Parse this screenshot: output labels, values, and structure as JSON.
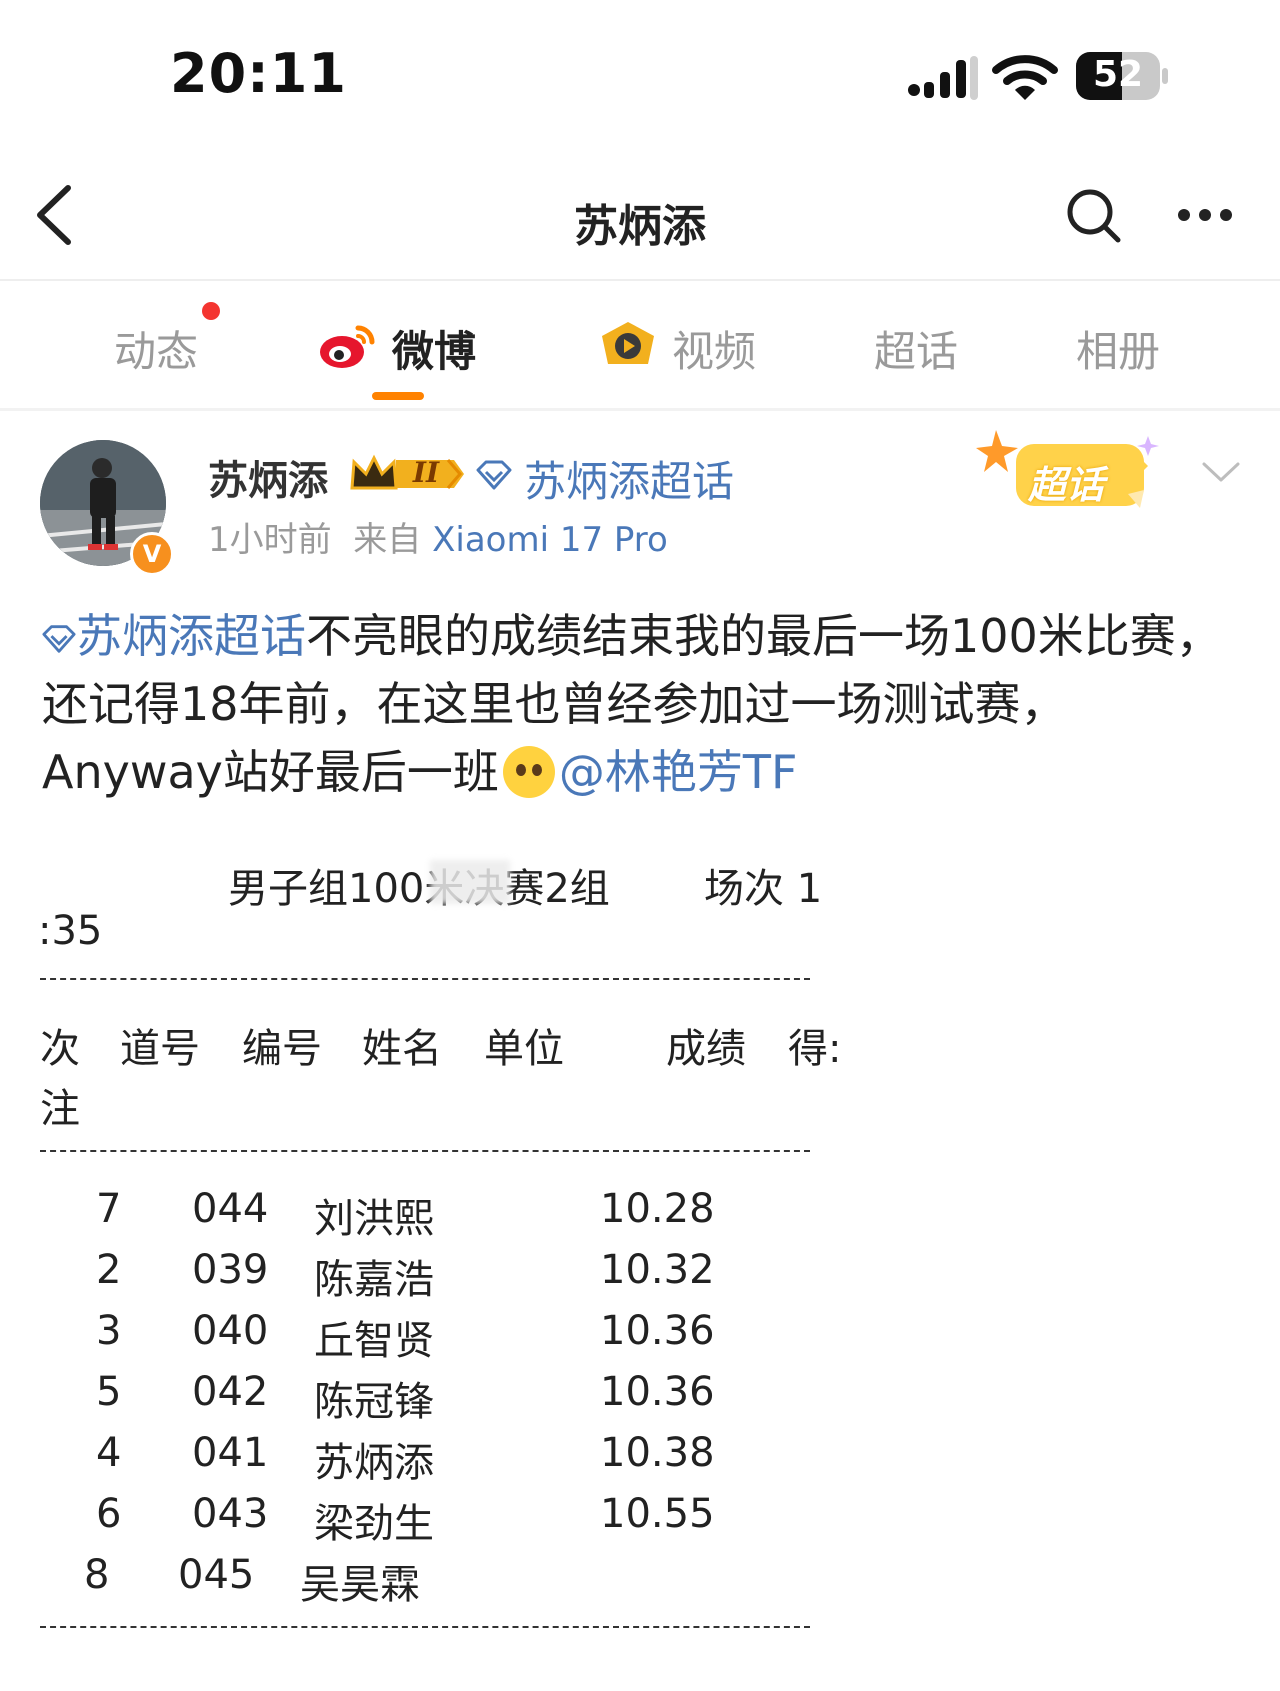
{
  "status_bar": {
    "time": "20:11",
    "battery": "52"
  },
  "nav": {
    "title": "苏炳添"
  },
  "tabs": [
    {
      "label": "动态"
    },
    {
      "label": "微博",
      "active": true
    },
    {
      "label": "视频"
    },
    {
      "label": "超话"
    },
    {
      "label": "相册"
    }
  ],
  "post": {
    "author": "苏炳添",
    "level_badge": "II",
    "super_topic": "苏炳添超话",
    "time": "1小时前",
    "source_prefix": "来自",
    "device": "Xiaomi 17 Pro",
    "chaohua_badge": "超话",
    "avatar_badge": "V",
    "text_topic": "苏炳添超话",
    "text_main": "不亮眼的成绩结束我的最后一场100米比赛，还记得18年前，在这里也曾经参加过一场测试赛，Anyway站好最后一班",
    "mention": "@林艳芳TF"
  },
  "sheet": {
    "heading": "男子组100米决赛2组",
    "heading_tail": "场次 1",
    "time_line": ":35",
    "columns": [
      "次",
      "道号",
      "编号",
      "姓名",
      "单位",
      "成绩",
      "得:"
    ],
    "note_label": "注",
    "rows": [
      {
        "lane": "7",
        "id": "044",
        "name": "刘洪熙",
        "result": "10.28"
      },
      {
        "lane": "2",
        "id": "039",
        "name": "陈嘉浩",
        "result": "10.32"
      },
      {
        "lane": "3",
        "id": "040",
        "name": "丘智贤",
        "result": "10.36"
      },
      {
        "lane": "5",
        "id": "042",
        "name": "陈冠锋",
        "result": "10.36"
      },
      {
        "lane": "4",
        "id": "041",
        "name": "苏炳添",
        "result": "10.38"
      },
      {
        "lane": "6",
        "id": "043",
        "name": "梁劲生",
        "result": "10.55"
      },
      {
        "lane": "8",
        "id": "045",
        "name": "吴昊霖",
        "result": ""
      }
    ]
  },
  "colors": {
    "accent": "#ff8200",
    "link": "#4a78b8",
    "notify_dot": "#f43530",
    "verified": "#f7901e"
  },
  "icons": [
    "back-icon",
    "search-icon",
    "more-icon",
    "weibo-icon",
    "video-icon",
    "supertopic-diamond-icon",
    "crown-icon",
    "chevron-down-icon"
  ]
}
